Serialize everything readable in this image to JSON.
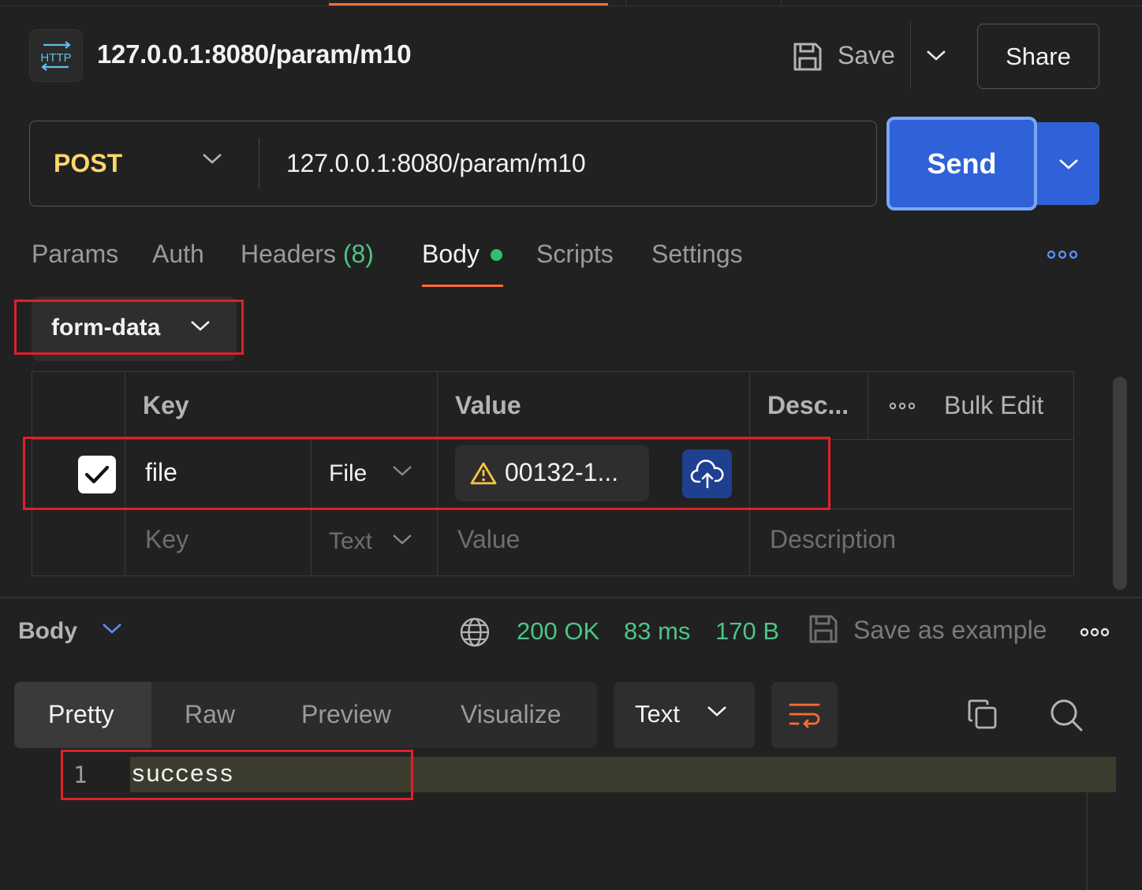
{
  "header": {
    "badge": "HTTP",
    "title": "127.0.0.1:8080/param/m10",
    "save_label": "Save",
    "share_label": "Share"
  },
  "request": {
    "method": "POST",
    "url": "127.0.0.1:8080/param/m10",
    "send_label": "Send"
  },
  "tabs": {
    "params": "Params",
    "auth": "Auth",
    "headers": "Headers",
    "headers_count": "(8)",
    "body": "Body",
    "scripts": "Scripts",
    "settings": "Settings"
  },
  "body_mode": "form-data",
  "table": {
    "headers": {
      "key": "Key",
      "value": "Value",
      "description": "Desc...",
      "bulk_edit": "Bulk Edit"
    },
    "rows": [
      {
        "checked": true,
        "key": "file",
        "type": "File",
        "value": "00132-1...",
        "description": ""
      }
    ],
    "placeholders": {
      "key": "Key",
      "type": "Text",
      "value": "Value",
      "description": "Description"
    }
  },
  "response": {
    "body_label": "Body",
    "status": "200 OK",
    "time": "83 ms",
    "size": "170 B",
    "save_example": "Save as example",
    "view_tabs": [
      "Pretty",
      "Raw",
      "Preview",
      "Visualize"
    ],
    "format": "Text",
    "lines": [
      {
        "number": "1",
        "text": "success"
      }
    ]
  },
  "colors": {
    "accent": "#ff6c37",
    "send": "#2f62d8",
    "method": "#ffd66a",
    "status": "#4cc486",
    "highlight_box": "#e0202a"
  }
}
